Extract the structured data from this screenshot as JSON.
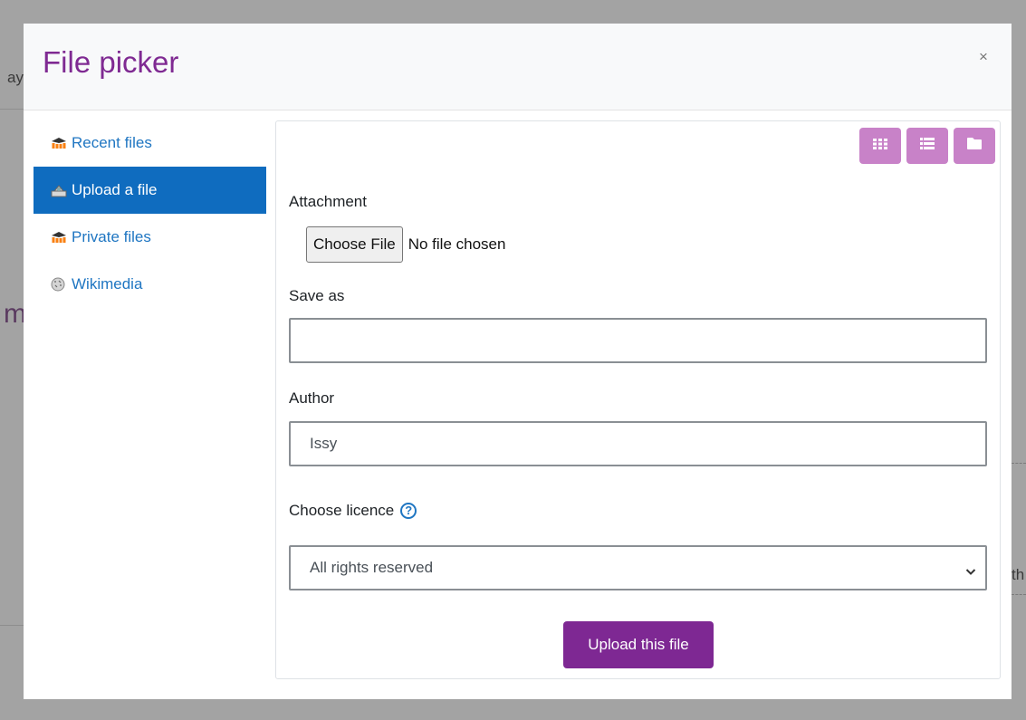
{
  "background": {
    "text_left_top": "ay",
    "text_left_mid": "m",
    "text_right": "th"
  },
  "dialog": {
    "title": "File picker",
    "close_label": "×"
  },
  "sidebar": {
    "items": [
      {
        "label": "Recent files",
        "icon": "moodle-icon",
        "active": false
      },
      {
        "label": "Upload a file",
        "icon": "upload-icon",
        "active": true
      },
      {
        "label": "Private files",
        "icon": "moodle-icon",
        "active": false
      },
      {
        "label": "Wikimedia",
        "icon": "wikimedia-icon",
        "active": false
      }
    ]
  },
  "toolbar": {
    "views": [
      "grid-view-icon",
      "list-view-icon",
      "folder-view-icon"
    ]
  },
  "form": {
    "attachment_label": "Attachment",
    "choose_file_label": "Choose File",
    "file_status": "No file chosen",
    "save_as_label": "Save as",
    "save_as_value": "",
    "author_label": "Author",
    "author_value": "Issy",
    "licence_label": "Choose licence",
    "licence_value": "All rights reserved",
    "upload_button": "Upload this file"
  },
  "colors": {
    "title": "#7f2a92",
    "active_item": "#0f6cbf",
    "link": "#1f76c2",
    "view_button": "#c882c8",
    "primary_button": "#7e2893"
  }
}
